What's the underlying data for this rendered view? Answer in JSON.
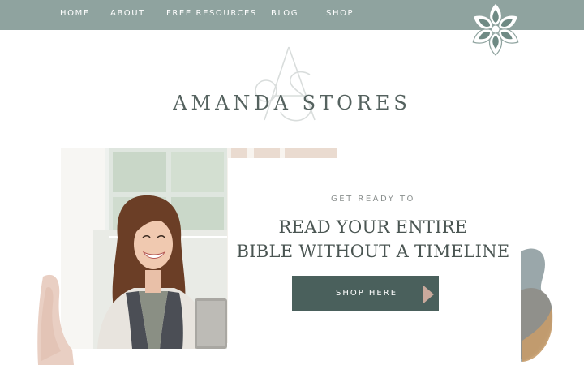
{
  "nav": {
    "items": [
      {
        "label": "HOME"
      },
      {
        "label": "ABOUT"
      },
      {
        "label": "FREE RESOURCES"
      },
      {
        "label": "BLOG"
      },
      {
        "label": "SHOP"
      }
    ]
  },
  "logo": {
    "monogram": "AS",
    "brand_name": "AMANDA STORES"
  },
  "hero": {
    "eyebrow": "GET READY TO",
    "headline_line1": "READ YOUR ENTIRE",
    "headline_line2": "BIBLE WITHOUT A TIMELINE",
    "cta_label": "SHOP HERE"
  },
  "colors": {
    "nav_bg": "#8fa39f",
    "cta_bg": "#4a605c",
    "cta_arrow": "#c9a99c",
    "heading_text": "#4a5552"
  },
  "icons": {
    "flower": "flower-ornament-icon",
    "arrow": "arrow-right-icon"
  }
}
